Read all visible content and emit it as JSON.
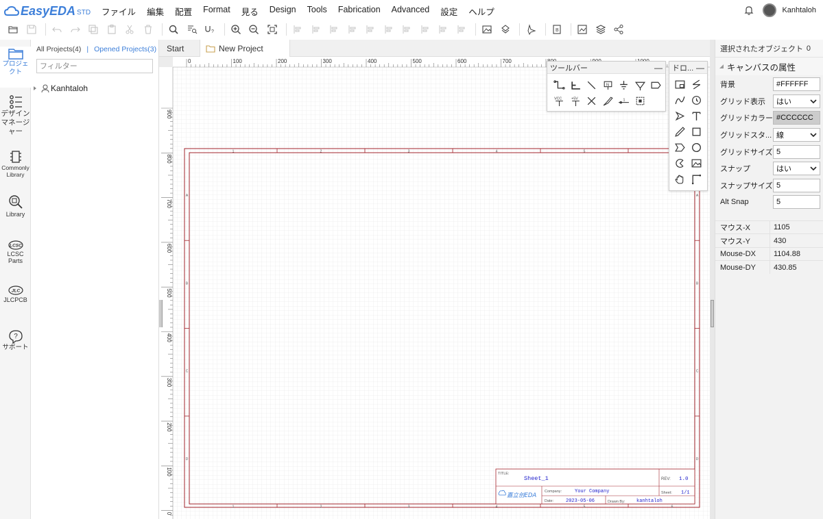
{
  "app": {
    "logo_text": "EasyEDA",
    "logo_badge": "STD",
    "brand_color": "#3d7fd9"
  },
  "menu": [
    "ファイル",
    "編集",
    "配置",
    "Format",
    "見る",
    "Design",
    "Tools",
    "Fabrication",
    "Advanced",
    "設定",
    "ヘルプ"
  ],
  "user": {
    "name": "Kanhtaloh",
    "icon": "bell-icon"
  },
  "toolbar_icons": [
    "open-icon",
    "save-icon",
    "|",
    "undo-icon",
    "redo-icon",
    "copy-icon",
    "paste-icon",
    "cut-icon",
    "delete-icon",
    "|",
    "find-icon",
    "find-replace-icon",
    "text-format-icon",
    "|",
    "zoom-in-icon",
    "zoom-out-icon",
    "fit-icon",
    "|",
    "align-left-icon",
    "align-right-icon",
    "align-top-icon",
    "align-bottom-icon",
    "align-center-h-icon",
    "align-center-v-icon",
    "align-grid-icon",
    "distribute-h-icon",
    "distribute-v-icon",
    "align-snap-icon",
    "|",
    "image-icon",
    "export-icon",
    "|",
    "highlight-icon",
    "|",
    "bom-icon",
    "|",
    "svg-icon",
    "layers-icon",
    "share-icon"
  ],
  "leftbar": [
    {
      "label": "プロジェクト",
      "icon": "folder-icon",
      "active": true
    },
    {
      "label": "デザインマネージャー",
      "icon": "design-manager-icon",
      "active": false
    },
    {
      "label": "Commonly Library",
      "icon": "chip-icon",
      "active": false
    },
    {
      "label": "Library",
      "icon": "library-search-icon",
      "active": false
    },
    {
      "label": "LCSC Parts",
      "icon": "lcsc-icon",
      "active": false
    },
    {
      "label": "JLCPCB",
      "icon": "jlc-icon",
      "active": false
    },
    {
      "label": "サポート",
      "icon": "help-icon",
      "active": false
    }
  ],
  "projects": {
    "all_tab": "All Projects(4)",
    "separator": "|",
    "opened_tab": "Opened Projects(3)",
    "filter_placeholder": "フィルター",
    "tree": [
      {
        "label": "Kanhtaloh",
        "icon": "user-icon"
      }
    ]
  },
  "doc_tabs": [
    {
      "label": "Start",
      "active": false
    },
    {
      "label": "New Project",
      "active": true,
      "icon": "folder-icon"
    }
  ],
  "canvas": {
    "ruler_top": [
      "0",
      "100",
      "200",
      "300",
      "400",
      "500",
      "600",
      "700",
      "800",
      "900",
      "1000"
    ],
    "ruler_left": [
      "900",
      "800",
      "700",
      "600",
      "500",
      "400",
      "300",
      "200",
      "100",
      "0"
    ],
    "frame_columns": [
      "1",
      "2",
      "3",
      "4",
      "5",
      "6"
    ],
    "frame_rows": [
      "A",
      "B",
      "C",
      "D"
    ],
    "title_block": {
      "title_label": "TITLE:",
      "title_value": "Sheet_1",
      "rev_label": "REV:",
      "rev_value": "1.0",
      "company_label": "Company:",
      "company_value": "Your Company",
      "sheet_label": "Sheet:",
      "sheet_value": "1/1",
      "date_label": "Date:",
      "date_value": "2023-05-06",
      "drawn_label": "Drawn By:",
      "drawn_value": "kanhtaloh",
      "logo": "嘉立创EDA"
    },
    "frame_color": "#a2232b"
  },
  "toolbar_panel": {
    "title": "ツールバー",
    "minimize": "—",
    "tools": [
      "wire-icon",
      "bus-icon",
      "bus-entry-icon",
      "net-label-icon",
      "gnd-icon",
      "net-port-icon",
      "net-flag-icon",
      "vcc-icon",
      "plus5v-icon",
      "no-connect-icon",
      "voltage-probe-icon",
      "pin-icon",
      "group-icon"
    ]
  },
  "draw_panel": {
    "title": "ドロ...",
    "minimize": "—",
    "tools": [
      "image-frame-icon",
      "line-icon",
      "bezier-icon",
      "arc-icon",
      "arrow-icon",
      "text-icon",
      "freehand-icon",
      "rect-icon",
      "polygon-icon",
      "circle-icon",
      "pie-icon",
      "picture-icon",
      "drag-icon",
      "anchor-icon"
    ]
  },
  "properties": {
    "selected_label": "選択されたオブジェクト",
    "selected_count": "0",
    "section_title": "キャンバスの属性",
    "rows": [
      {
        "label": "背景",
        "value": "#FFFFFF",
        "type": "text"
      },
      {
        "label": "グリッド表示",
        "value": "はい",
        "type": "select"
      },
      {
        "label": "グリッドカラー",
        "value": "#CCCCCC",
        "type": "grey"
      },
      {
        "label": "グリッドスタ...",
        "value": "線",
        "type": "select"
      },
      {
        "label": "グリッドサイズ",
        "value": "5",
        "type": "text"
      },
      {
        "label": "スナップ",
        "value": "はい",
        "type": "select"
      },
      {
        "label": "スナップサイズ",
        "value": "5",
        "type": "text"
      },
      {
        "label": "Alt Snap",
        "value": "5",
        "type": "text"
      }
    ],
    "mouse": [
      {
        "label": "マウス-X",
        "value": "1105"
      },
      {
        "label": "マウス-Y",
        "value": "430"
      },
      {
        "label": "Mouse-DX",
        "value": "1104.88"
      },
      {
        "label": "Mouse-DY",
        "value": "430.85"
      }
    ]
  }
}
